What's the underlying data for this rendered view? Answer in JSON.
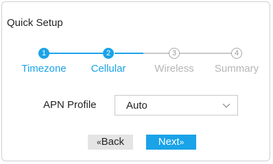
{
  "title": "Quick Setup",
  "colors": {
    "accent": "#1aa3e8",
    "inactive_text": "#b5b5b5",
    "inactive_line": "#c8c8c8",
    "secondary_button": "#e4e4e4"
  },
  "steps": [
    {
      "number": "1",
      "label": "Timezone",
      "state": "active"
    },
    {
      "number": "2",
      "label": "Cellular",
      "state": "active"
    },
    {
      "number": "3",
      "label": "Wireless",
      "state": "inactive"
    },
    {
      "number": "4",
      "label": "Summary",
      "state": "inactive"
    }
  ],
  "apn": {
    "label": "APN Profile",
    "value": "Auto",
    "dropdown_icon": "chevron-down-icon"
  },
  "buttons": {
    "back_label": "Back",
    "back_prefix": "«",
    "next_label": "Next",
    "next_suffix": "»"
  }
}
